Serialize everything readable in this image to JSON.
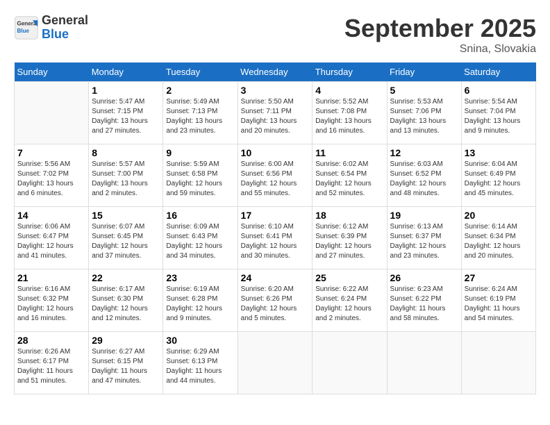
{
  "header": {
    "logo_general": "General",
    "logo_blue": "Blue",
    "month_year": "September 2025",
    "location": "Snina, Slovakia"
  },
  "days_of_week": [
    "Sunday",
    "Monday",
    "Tuesday",
    "Wednesday",
    "Thursday",
    "Friday",
    "Saturday"
  ],
  "weeks": [
    [
      {
        "day": "",
        "info": ""
      },
      {
        "day": "1",
        "info": "Sunrise: 5:47 AM\nSunset: 7:15 PM\nDaylight: 13 hours\nand 27 minutes."
      },
      {
        "day": "2",
        "info": "Sunrise: 5:49 AM\nSunset: 7:13 PM\nDaylight: 13 hours\nand 23 minutes."
      },
      {
        "day": "3",
        "info": "Sunrise: 5:50 AM\nSunset: 7:11 PM\nDaylight: 13 hours\nand 20 minutes."
      },
      {
        "day": "4",
        "info": "Sunrise: 5:52 AM\nSunset: 7:08 PM\nDaylight: 13 hours\nand 16 minutes."
      },
      {
        "day": "5",
        "info": "Sunrise: 5:53 AM\nSunset: 7:06 PM\nDaylight: 13 hours\nand 13 minutes."
      },
      {
        "day": "6",
        "info": "Sunrise: 5:54 AM\nSunset: 7:04 PM\nDaylight: 13 hours\nand 9 minutes."
      }
    ],
    [
      {
        "day": "7",
        "info": "Sunrise: 5:56 AM\nSunset: 7:02 PM\nDaylight: 13 hours\nand 6 minutes."
      },
      {
        "day": "8",
        "info": "Sunrise: 5:57 AM\nSunset: 7:00 PM\nDaylight: 13 hours\nand 2 minutes."
      },
      {
        "day": "9",
        "info": "Sunrise: 5:59 AM\nSunset: 6:58 PM\nDaylight: 12 hours\nand 59 minutes."
      },
      {
        "day": "10",
        "info": "Sunrise: 6:00 AM\nSunset: 6:56 PM\nDaylight: 12 hours\nand 55 minutes."
      },
      {
        "day": "11",
        "info": "Sunrise: 6:02 AM\nSunset: 6:54 PM\nDaylight: 12 hours\nand 52 minutes."
      },
      {
        "day": "12",
        "info": "Sunrise: 6:03 AM\nSunset: 6:52 PM\nDaylight: 12 hours\nand 48 minutes."
      },
      {
        "day": "13",
        "info": "Sunrise: 6:04 AM\nSunset: 6:49 PM\nDaylight: 12 hours\nand 45 minutes."
      }
    ],
    [
      {
        "day": "14",
        "info": "Sunrise: 6:06 AM\nSunset: 6:47 PM\nDaylight: 12 hours\nand 41 minutes."
      },
      {
        "day": "15",
        "info": "Sunrise: 6:07 AM\nSunset: 6:45 PM\nDaylight: 12 hours\nand 37 minutes."
      },
      {
        "day": "16",
        "info": "Sunrise: 6:09 AM\nSunset: 6:43 PM\nDaylight: 12 hours\nand 34 minutes."
      },
      {
        "day": "17",
        "info": "Sunrise: 6:10 AM\nSunset: 6:41 PM\nDaylight: 12 hours\nand 30 minutes."
      },
      {
        "day": "18",
        "info": "Sunrise: 6:12 AM\nSunset: 6:39 PM\nDaylight: 12 hours\nand 27 minutes."
      },
      {
        "day": "19",
        "info": "Sunrise: 6:13 AM\nSunset: 6:37 PM\nDaylight: 12 hours\nand 23 minutes."
      },
      {
        "day": "20",
        "info": "Sunrise: 6:14 AM\nSunset: 6:34 PM\nDaylight: 12 hours\nand 20 minutes."
      }
    ],
    [
      {
        "day": "21",
        "info": "Sunrise: 6:16 AM\nSunset: 6:32 PM\nDaylight: 12 hours\nand 16 minutes."
      },
      {
        "day": "22",
        "info": "Sunrise: 6:17 AM\nSunset: 6:30 PM\nDaylight: 12 hours\nand 12 minutes."
      },
      {
        "day": "23",
        "info": "Sunrise: 6:19 AM\nSunset: 6:28 PM\nDaylight: 12 hours\nand 9 minutes."
      },
      {
        "day": "24",
        "info": "Sunrise: 6:20 AM\nSunset: 6:26 PM\nDaylight: 12 hours\nand 5 minutes."
      },
      {
        "day": "25",
        "info": "Sunrise: 6:22 AM\nSunset: 6:24 PM\nDaylight: 12 hours\nand 2 minutes."
      },
      {
        "day": "26",
        "info": "Sunrise: 6:23 AM\nSunset: 6:22 PM\nDaylight: 11 hours\nand 58 minutes."
      },
      {
        "day": "27",
        "info": "Sunrise: 6:24 AM\nSunset: 6:19 PM\nDaylight: 11 hours\nand 54 minutes."
      }
    ],
    [
      {
        "day": "28",
        "info": "Sunrise: 6:26 AM\nSunset: 6:17 PM\nDaylight: 11 hours\nand 51 minutes."
      },
      {
        "day": "29",
        "info": "Sunrise: 6:27 AM\nSunset: 6:15 PM\nDaylight: 11 hours\nand 47 minutes."
      },
      {
        "day": "30",
        "info": "Sunrise: 6:29 AM\nSunset: 6:13 PM\nDaylight: 11 hours\nand 44 minutes."
      },
      {
        "day": "",
        "info": ""
      },
      {
        "day": "",
        "info": ""
      },
      {
        "day": "",
        "info": ""
      },
      {
        "day": "",
        "info": ""
      }
    ]
  ]
}
